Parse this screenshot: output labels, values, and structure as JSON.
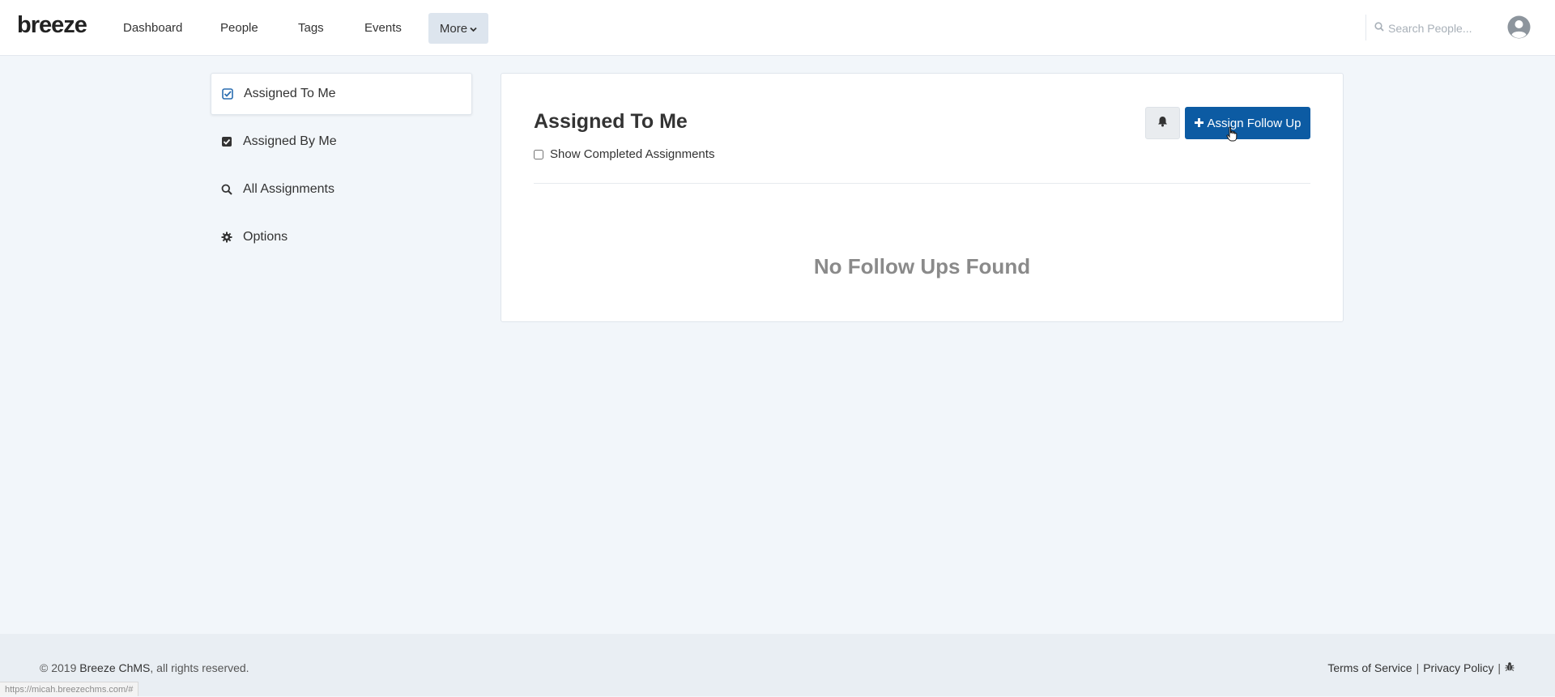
{
  "nav": {
    "logo": "breeze",
    "items": [
      {
        "label": "Dashboard"
      },
      {
        "label": "People"
      },
      {
        "label": "Tags"
      },
      {
        "label": "Events"
      }
    ],
    "more_label": "More",
    "search_placeholder": "Search People...",
    "icons": {
      "search": "search-icon",
      "avatar": "user-avatar-icon",
      "more": "chevron-down-icon"
    }
  },
  "sidebar": {
    "items": [
      {
        "label": "Assigned To Me",
        "icon": "check-square-icon",
        "active": true
      },
      {
        "label": "Assigned By Me",
        "icon": "check-square-filled-icon",
        "active": false
      },
      {
        "label": "All Assignments",
        "icon": "search-icon",
        "active": false
      },
      {
        "label": "Options",
        "icon": "gear-icon",
        "active": false
      }
    ]
  },
  "main": {
    "title": "Assigned To Me",
    "show_completed_label": "Show Completed Assignments",
    "show_completed_checked": false,
    "assign_button_label": "Assign Follow Up",
    "empty_message": "No Follow Ups Found"
  },
  "footer": {
    "copyright_prefix": "© 2019 ",
    "brand": "Breeze ChMS",
    "copyright_suffix": ", all rights reserved.",
    "terms": "Terms of Service",
    "privacy": "Privacy Policy",
    "separator": "|"
  },
  "status_url": "https://micah.breezechms.com/#",
  "colors": {
    "primary_button": "#0c5ba3",
    "page_bg": "#f2f6fa",
    "accent_icon": "#2a6db0"
  }
}
